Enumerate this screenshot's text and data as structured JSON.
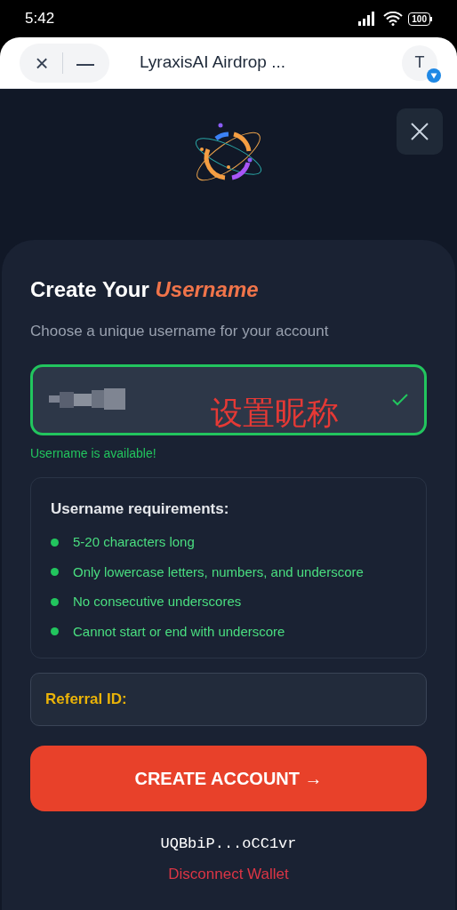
{
  "status_bar": {
    "time": "5:42",
    "battery": "100"
  },
  "browser": {
    "close": "×",
    "minimize": "—",
    "title": "LyraxisAI Airdrop ...",
    "avatar": "T"
  },
  "form": {
    "title": "Create Your **Username**",
    "subtitle": "Choose a unique username for your account",
    "username": {
      "valid": true,
      "annotation": "设置昵称"
    },
    "message": "Username is available!",
    "requirements": {
      "title": "Username requirements:",
      "items": [
        {
          "text": "5-20 characters long",
          "met": true
        },
        {
          "text": "Only lowercase letters, numbers, and underscore",
          "met": true
        },
        {
          "text": "No consecutive underscores",
          "met": true
        },
        {
          "text": "Cannot start or end with underscore",
          "met": true
        }
      ]
    },
    "referral": {
      "label": "Referral ID:"
    },
    "button": "CREATE ACCOUNT →",
    "wallet": "UQBbiP...oCC1vr",
    "disconnect": "Disconnect Wallet"
  }
}
